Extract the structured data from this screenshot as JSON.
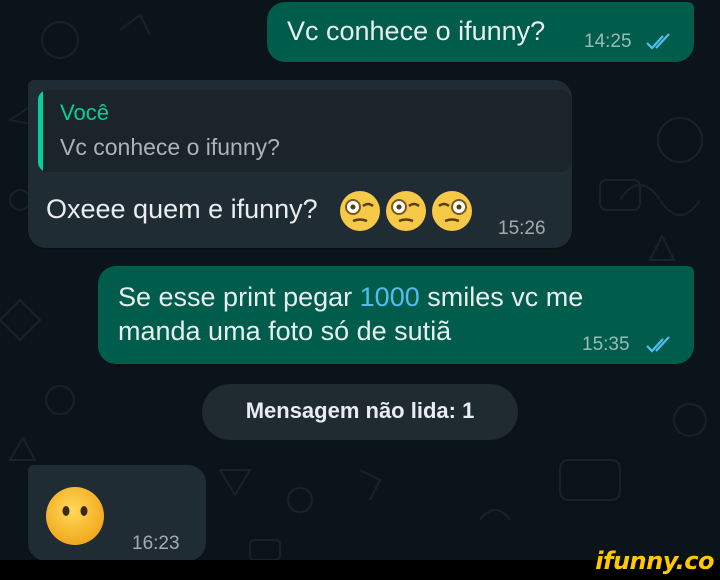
{
  "colors": {
    "background": "#0b141a",
    "outgoing_bubble": "#005c4b",
    "incoming_bubble": "#202c33",
    "read_ticks": "#53bdeb",
    "quote_accent": "#06cf9c",
    "watermark": "#ffc800"
  },
  "messages": [
    {
      "direction": "outgoing",
      "text": "Vc conhece o ifunny?",
      "time": "14:25",
      "status_icon": "double-check-read-icon"
    },
    {
      "direction": "incoming",
      "quote": {
        "author": "Você",
        "text": "Vc conhece o ifunny?"
      },
      "text": "Oxeee quem e ifunny?",
      "emojis": [
        "face-with-monocle-icon",
        "face-with-monocle-icon",
        "face-with-monocle-icon"
      ],
      "time": "15:26"
    },
    {
      "direction": "outgoing",
      "line1_before": "Se esse print pegar ",
      "line1_number": "1000",
      "line1_after": " smiles vc me",
      "line2": "manda uma foto só de sutiã",
      "time": "15:35",
      "status_icon": "double-check-read-icon"
    },
    {
      "direction": "incoming",
      "emojis": [
        "face-without-mouth-icon"
      ],
      "time": "16:23"
    }
  ],
  "unread_divider": {
    "label": "Mensagem não lida: 1"
  },
  "watermark": {
    "text": "ifunny.co"
  }
}
